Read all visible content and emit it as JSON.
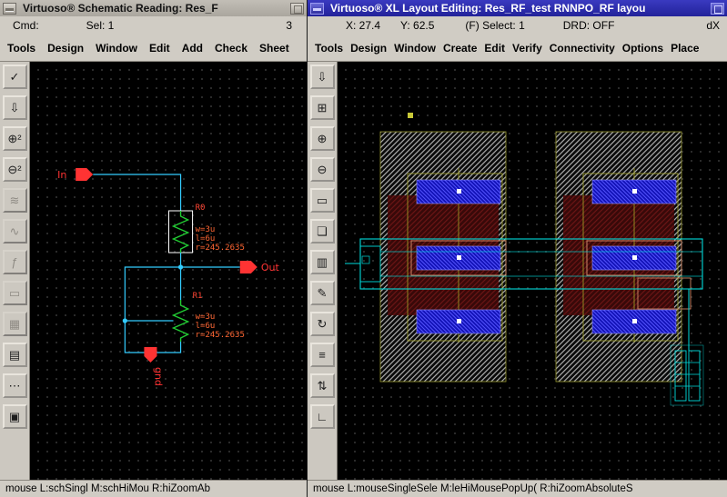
{
  "left_window": {
    "titlebar": {
      "title": "Virtuoso® Schematic Reading: Res_F"
    },
    "info_row": {
      "cmd": "Cmd:",
      "sel": "Sel: 1",
      "count": "3"
    },
    "menus": [
      "Tools",
      "Design",
      "Window",
      "Edit",
      "Add",
      "Check",
      "Sheet"
    ],
    "toolbar": [
      {
        "name": "select-check-icon",
        "glyph": "✓"
      },
      {
        "name": "descend-icon",
        "glyph": "⇩"
      },
      {
        "name": "zoom-in-2x-icon",
        "glyph": "⊕²"
      },
      {
        "name": "zoom-out-2x-icon",
        "glyph": "⊖²"
      },
      {
        "name": "stretch-icon",
        "glyph": "≋"
      },
      {
        "name": "wave-icon",
        "glyph": "∿"
      },
      {
        "name": "function-icon",
        "glyph": "ƒ"
      },
      {
        "name": "dashed-box-icon",
        "glyph": "▭"
      },
      {
        "name": "pattern-grid-icon",
        "glyph": "▦"
      },
      {
        "name": "rows-icon",
        "glyph": "▤"
      },
      {
        "name": "dots-icon",
        "glyph": "⋯"
      },
      {
        "name": "solid-box-icon",
        "glyph": "▣"
      }
    ],
    "schematic": {
      "in_port": "In",
      "out_port": "Out",
      "gnd_port": "gnd",
      "r0": {
        "name": "R0",
        "w": "w=3u",
        "l": "l=6u",
        "r": "r=245.2635"
      },
      "r1": {
        "name": "R1",
        "w": "w=3u",
        "l": "l=6u",
        "r": "r=245.2635"
      }
    },
    "status": "mouse L:schSingl M:schHiMou R:hiZoomAb"
  },
  "right_window": {
    "titlebar": {
      "title": "Virtuoso® XL Layout Editing: Res_RF_test RNNPO_RF layou"
    },
    "info_row": {
      "x": "X: 27.4",
      "y": "Y: 62.5",
      "select": "(F) Select: 1",
      "drd": "DRD: OFF",
      "dx": "dX"
    },
    "menus": [
      "Tools",
      "Design",
      "Window",
      "Create",
      "Edit",
      "Verify",
      "Connectivity",
      "Options",
      "Place"
    ],
    "toolbar": [
      {
        "name": "save-icon",
        "glyph": "⇩"
      },
      {
        "name": "zoom-fit-icon",
        "glyph": "⊞"
      },
      {
        "name": "zoom-in-icon",
        "glyph": "⊕"
      },
      {
        "name": "zoom-out-icon",
        "glyph": "⊖"
      },
      {
        "name": "select-box-icon",
        "glyph": "▭"
      },
      {
        "name": "copy-icon",
        "glyph": "❏"
      },
      {
        "name": "stretch-icon",
        "glyph": "▥"
      },
      {
        "name": "ruler-icon",
        "glyph": "✎"
      },
      {
        "name": "rotate-icon",
        "glyph": "↻"
      },
      {
        "name": "properties-icon",
        "glyph": "≡"
      },
      {
        "name": "swap-icon",
        "glyph": "⇅"
      },
      {
        "name": "path-corner-icon",
        "glyph": "∟"
      }
    ],
    "status": "mouse L:mouseSingleSele M:leHiMousePopUp( R:hiZoomAbsoluteS"
  },
  "colors": {
    "active_titlebar": "#2a2aa8",
    "inactive_titlebar": "#b4b0a8",
    "panel_gray": "#d0ccc4",
    "canvas_black": "#000000",
    "wire_cyan": "#33ccff",
    "resistor_green": "#22cc33",
    "port_red": "#ff3333",
    "label_orange": "#ff6633",
    "layout_blue": "#1313b8",
    "layout_maroon": "#380909",
    "layout_hatch": "#b4b4b4",
    "layout_yellow": "#a8a828",
    "layout_cyan": "#00dcdc",
    "layout_tan": "#cc8866"
  }
}
